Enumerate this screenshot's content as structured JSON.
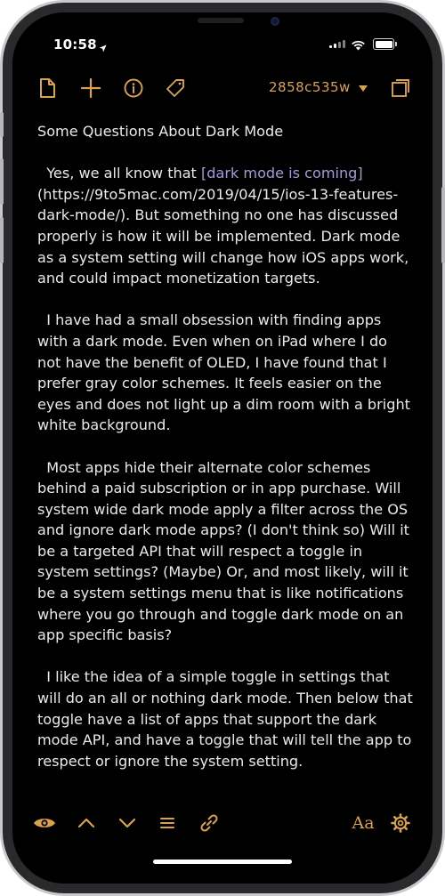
{
  "status_bar": {
    "time": "10:58",
    "location_icon": "location-arrow-icon",
    "signal_icon": "cellular-signal-icon",
    "wifi_icon": "wifi-icon",
    "battery_icon": "battery-icon",
    "battery_level": 1.0
  },
  "toolbar": {
    "new_note_icon": "new-document-icon",
    "add_icon": "plus-icon",
    "info_icon": "info-icon",
    "tag_icon": "tag-icon",
    "version_label": "2858c535w",
    "version_dropdown_icon": "caret-down-icon",
    "expand_icon": "expand-window-icon"
  },
  "document": {
    "title": "Some Questions About Dark Mode",
    "paragraphs": [
      {
        "lead": "  Yes, we all know that ",
        "link_text": "[dark mode is coming]",
        "tail": "(https://9to5mac.com/2019/04/15/ios-13-features-dark-mode/). But something no one has discussed properly is how it will be implemented. Dark mode as a system setting will change how iOS apps work, and could impact monetization targets."
      },
      {
        "text": "  I have had a small obsession with finding apps with a dark mode. Even when on iPad where I do not have the benefit of OLED, I have found that I prefer gray color schemes. It feels easier on the eyes and does not light up a dim room with a bright white background."
      },
      {
        "text": "  Most apps hide their alternate color schemes behind a paid subscription or in app purchase. Will system wide dark mode apply a filter across the OS and ignore dark mode apps? (I don't think so) Will it be a targeted API that will respect a toggle in system settings? (Maybe) Or, and most likely, will it be a system settings menu that is like notifications where you go through and toggle dark mode on an app specific basis?"
      },
      {
        "text": "  I like the idea of a simple toggle in settings that will do an all or nothing dark mode. Then below that toggle have a list of apps that support the dark mode API, and have a toggle that will tell the app to respect or ignore the system setting."
      }
    ]
  },
  "bottom_bar": {
    "preview_icon": "eye-icon",
    "previous_icon": "chevron-up-icon",
    "next_icon": "chevron-down-icon",
    "list_icon": "list-icon",
    "link_icon": "link-icon",
    "font_label": "Aa",
    "settings_icon": "gear-icon"
  },
  "colors": {
    "accent": "#d9a24c",
    "link": "#a69ad6",
    "text": "#eaeaea",
    "background": "#000000"
  }
}
